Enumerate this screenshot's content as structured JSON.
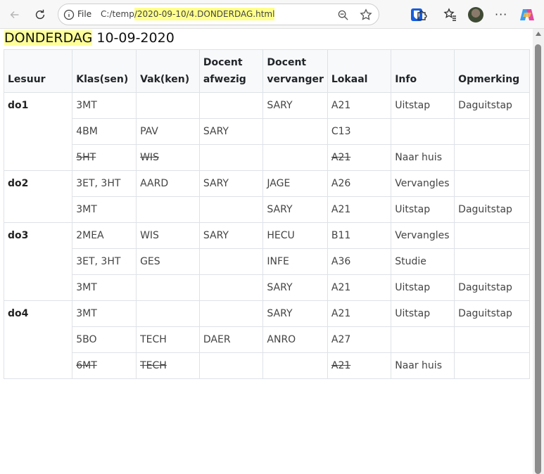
{
  "browser": {
    "file_label": "File",
    "url_prefix": "C:/temp",
    "url_highlight": "/2020-09-10/4.DONDERDAG.html"
  },
  "page": {
    "day_highlight": "DONDERDAG",
    "date": " 10-09-2020"
  },
  "table": {
    "headers": [
      "Lesuur",
      "Klas(sen)",
      "Vak(ken)",
      "Docent afwezig",
      "Docent vervanger",
      "Lokaal",
      "Info",
      "Opmerking"
    ],
    "groups": [
      {
        "lesuur": "do1",
        "rows": [
          {
            "klas": "3MT",
            "vak": "",
            "afwezig": "",
            "vervanger": "SARY",
            "lokaal": "A21",
            "info": "Uitstap",
            "opmerking": "Daguitstap",
            "struck": false
          },
          {
            "klas": "4BM",
            "vak": "PAV",
            "afwezig": "SARY",
            "vervanger": "",
            "lokaal": "C13",
            "info": "",
            "opmerking": "",
            "struck": false
          },
          {
            "klas": "5HT",
            "vak": "WIS",
            "afwezig": "",
            "vervanger": "",
            "lokaal": "A21",
            "info": "Naar huis",
            "opmerking": "",
            "struck": true
          }
        ]
      },
      {
        "lesuur": "do2",
        "rows": [
          {
            "klas": "3ET, 3HT",
            "vak": "AARD",
            "afwezig": "SARY",
            "vervanger": "JAGE",
            "lokaal": "A26",
            "info": "Vervangles",
            "opmerking": "",
            "struck": false
          },
          {
            "klas": "3MT",
            "vak": "",
            "afwezig": "",
            "vervanger": "SARY",
            "lokaal": "A21",
            "info": "Uitstap",
            "opmerking": "Daguitstap",
            "struck": false
          }
        ]
      },
      {
        "lesuur": "do3",
        "rows": [
          {
            "klas": "2MEA",
            "vak": "WIS",
            "afwezig": "SARY",
            "vervanger": "HECU",
            "lokaal": "B11",
            "info": "Vervangles",
            "opmerking": "",
            "struck": false
          },
          {
            "klas": "3ET, 3HT",
            "vak": "GES",
            "afwezig": "",
            "vervanger": "INFE",
            "lokaal": "A36",
            "info": "Studie",
            "opmerking": "",
            "struck": false
          },
          {
            "klas": "3MT",
            "vak": "",
            "afwezig": "",
            "vervanger": "SARY",
            "lokaal": "A21",
            "info": "Uitstap",
            "opmerking": "Daguitstap",
            "struck": false
          }
        ]
      },
      {
        "lesuur": "do4",
        "rows": [
          {
            "klas": "3MT",
            "vak": "",
            "afwezig": "",
            "vervanger": "SARY",
            "lokaal": "A21",
            "info": "Uitstap",
            "opmerking": "Daguitstap",
            "struck": false
          },
          {
            "klas": "5BO",
            "vak": "TECH",
            "afwezig": "DAER",
            "vervanger": "ANRO",
            "lokaal": "A27",
            "info": "",
            "opmerking": "",
            "struck": false
          },
          {
            "klas": "6MT",
            "vak": "TECH",
            "afwezig": "",
            "vervanger": "",
            "lokaal": "A21",
            "info": "Naar huis",
            "opmerking": "",
            "struck": true
          }
        ]
      }
    ]
  }
}
